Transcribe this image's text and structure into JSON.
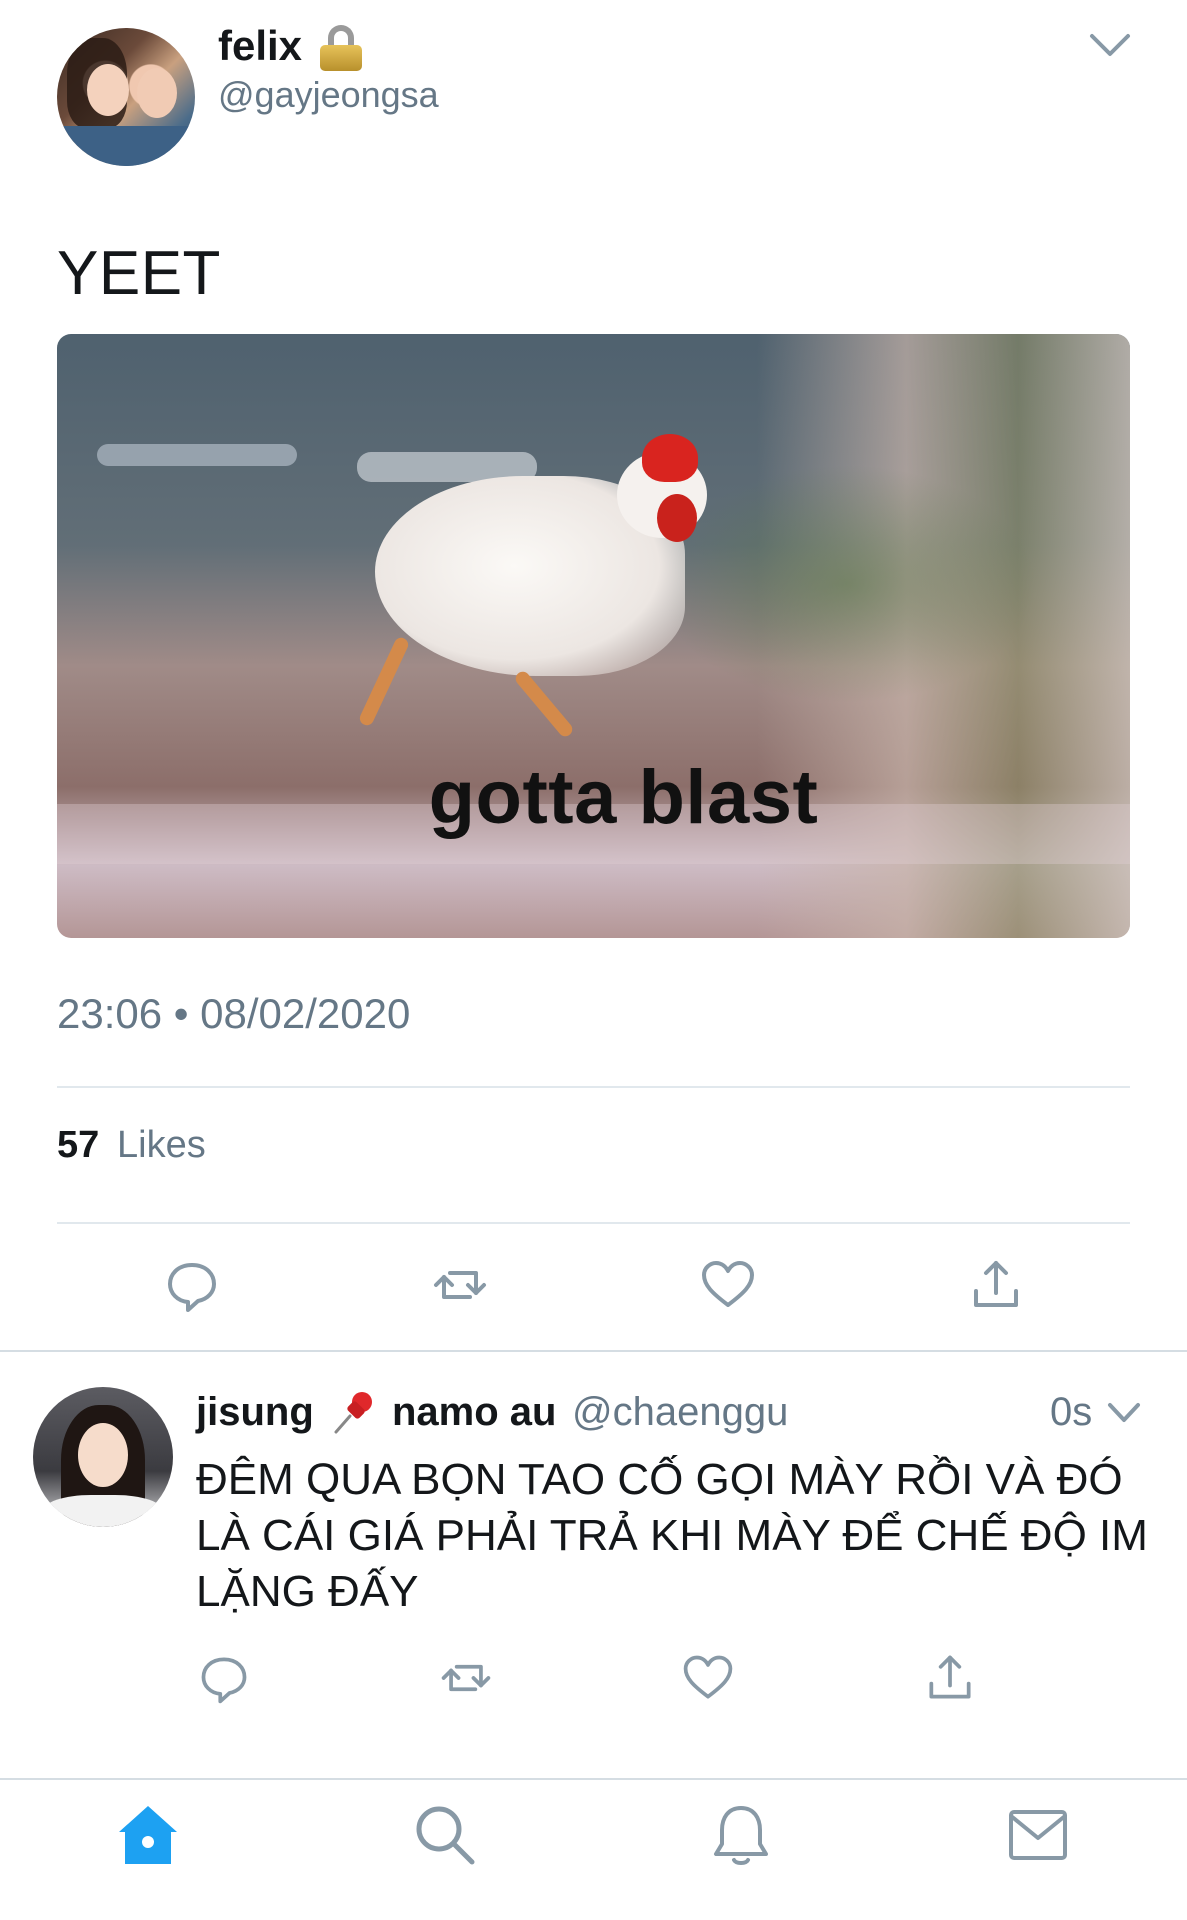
{
  "tweet": {
    "author_name": "felix",
    "author_handle": "@gayjeongsa",
    "protected_icon": "lock-icon",
    "text": "YEET",
    "media_caption": "gotta blast",
    "timestamp": "23:06 • 08/02/2020",
    "likes_count": "57",
    "likes_label": "Likes",
    "actions": [
      "reply-icon",
      "retweet-icon",
      "like-icon",
      "share-icon"
    ]
  },
  "reply": {
    "author_name": "jisung",
    "pin_icon": "pushpin-icon",
    "author_name_suffix": "namo au",
    "author_handle": "@chaenggu",
    "time": "0s",
    "text": "ĐÊM QUA BỌN TAO CỐ GỌI MÀY RỒI VÀ ĐÓ LÀ CÁI GIÁ PHẢI TRẢ KHI MÀY ĐỂ CHẾ ĐỘ IM LẶNG ĐẤY",
    "actions": [
      "reply-icon",
      "retweet-icon",
      "like-icon",
      "share-icon"
    ]
  },
  "tab_bar": {
    "tabs": [
      "home-icon",
      "search-icon",
      "notifications-icon",
      "messages-icon"
    ],
    "active": "home-icon"
  },
  "colors": {
    "accent": "#1da1f2",
    "icon_gray": "#8899a6",
    "secondary_text": "#657786",
    "divider": "#e1e8ed"
  }
}
